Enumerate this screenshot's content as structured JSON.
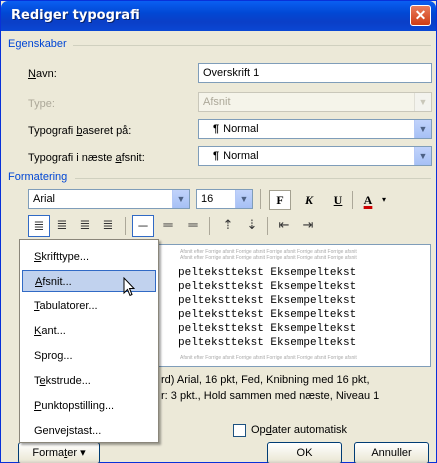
{
  "window": {
    "title": "Rediger typografi",
    "close_glyph": "✕"
  },
  "properties": {
    "group_label": "Egenskaber",
    "name_label": "Navn:",
    "name_value": "Overskrift 1",
    "type_label": "Type:",
    "type_value": "Afsnit",
    "based_on_label": "Typografi baseret på:",
    "based_on_value": "Normal",
    "next_label": "Typografi i næste afsnit:",
    "next_value": "Normal",
    "pilcrow": "¶"
  },
  "formatting": {
    "group_label": "Formatering",
    "font": "Arial",
    "size": "16",
    "bold_label": "F",
    "italic_label": "K",
    "underline_label": "U",
    "color_label": "A"
  },
  "preview": {
    "faint": "Afsnit efter Forrige afsnit Forrige afsnit Forrige afsnit Forrige afsnit Forrige afsnit",
    "lines": [
      "pelteksttekst Eksempeltekst",
      "pelteksttekst Eksempeltekst",
      "pelteksttekst Eksempeltekst",
      "pelteksttekst Eksempeltekst",
      "pelteksttekst Eksempeltekst",
      "pelteksttekst Eksempeltekst"
    ],
    "line_text": "pelteksttekst Eksempeltekst"
  },
  "description": {
    "line1": "rd) Arial, 16 pkt, Fed, Knibning med 16 pkt,",
    "line2": "r:  3 pkt., Hold sammen med næste, Niveau 1"
  },
  "options": {
    "auto_update_label": "Opdater automatisk"
  },
  "buttons": {
    "format": "Formater",
    "ok": "OK",
    "cancel": "Annuller"
  },
  "menu": {
    "items": [
      "Skrifttype...",
      "Afsnit...",
      "Tabulatorer...",
      "Kant...",
      "Sprog...",
      "Tekstrude...",
      "Punktopstilling...",
      "Genvejstast..."
    ],
    "highlighted": "Afsnit..."
  },
  "colors": {
    "title_bar": "#0148d4",
    "group_label": "#0046d5",
    "menu_highlight": "#c1d2ee",
    "font_color": "#cc0000"
  }
}
